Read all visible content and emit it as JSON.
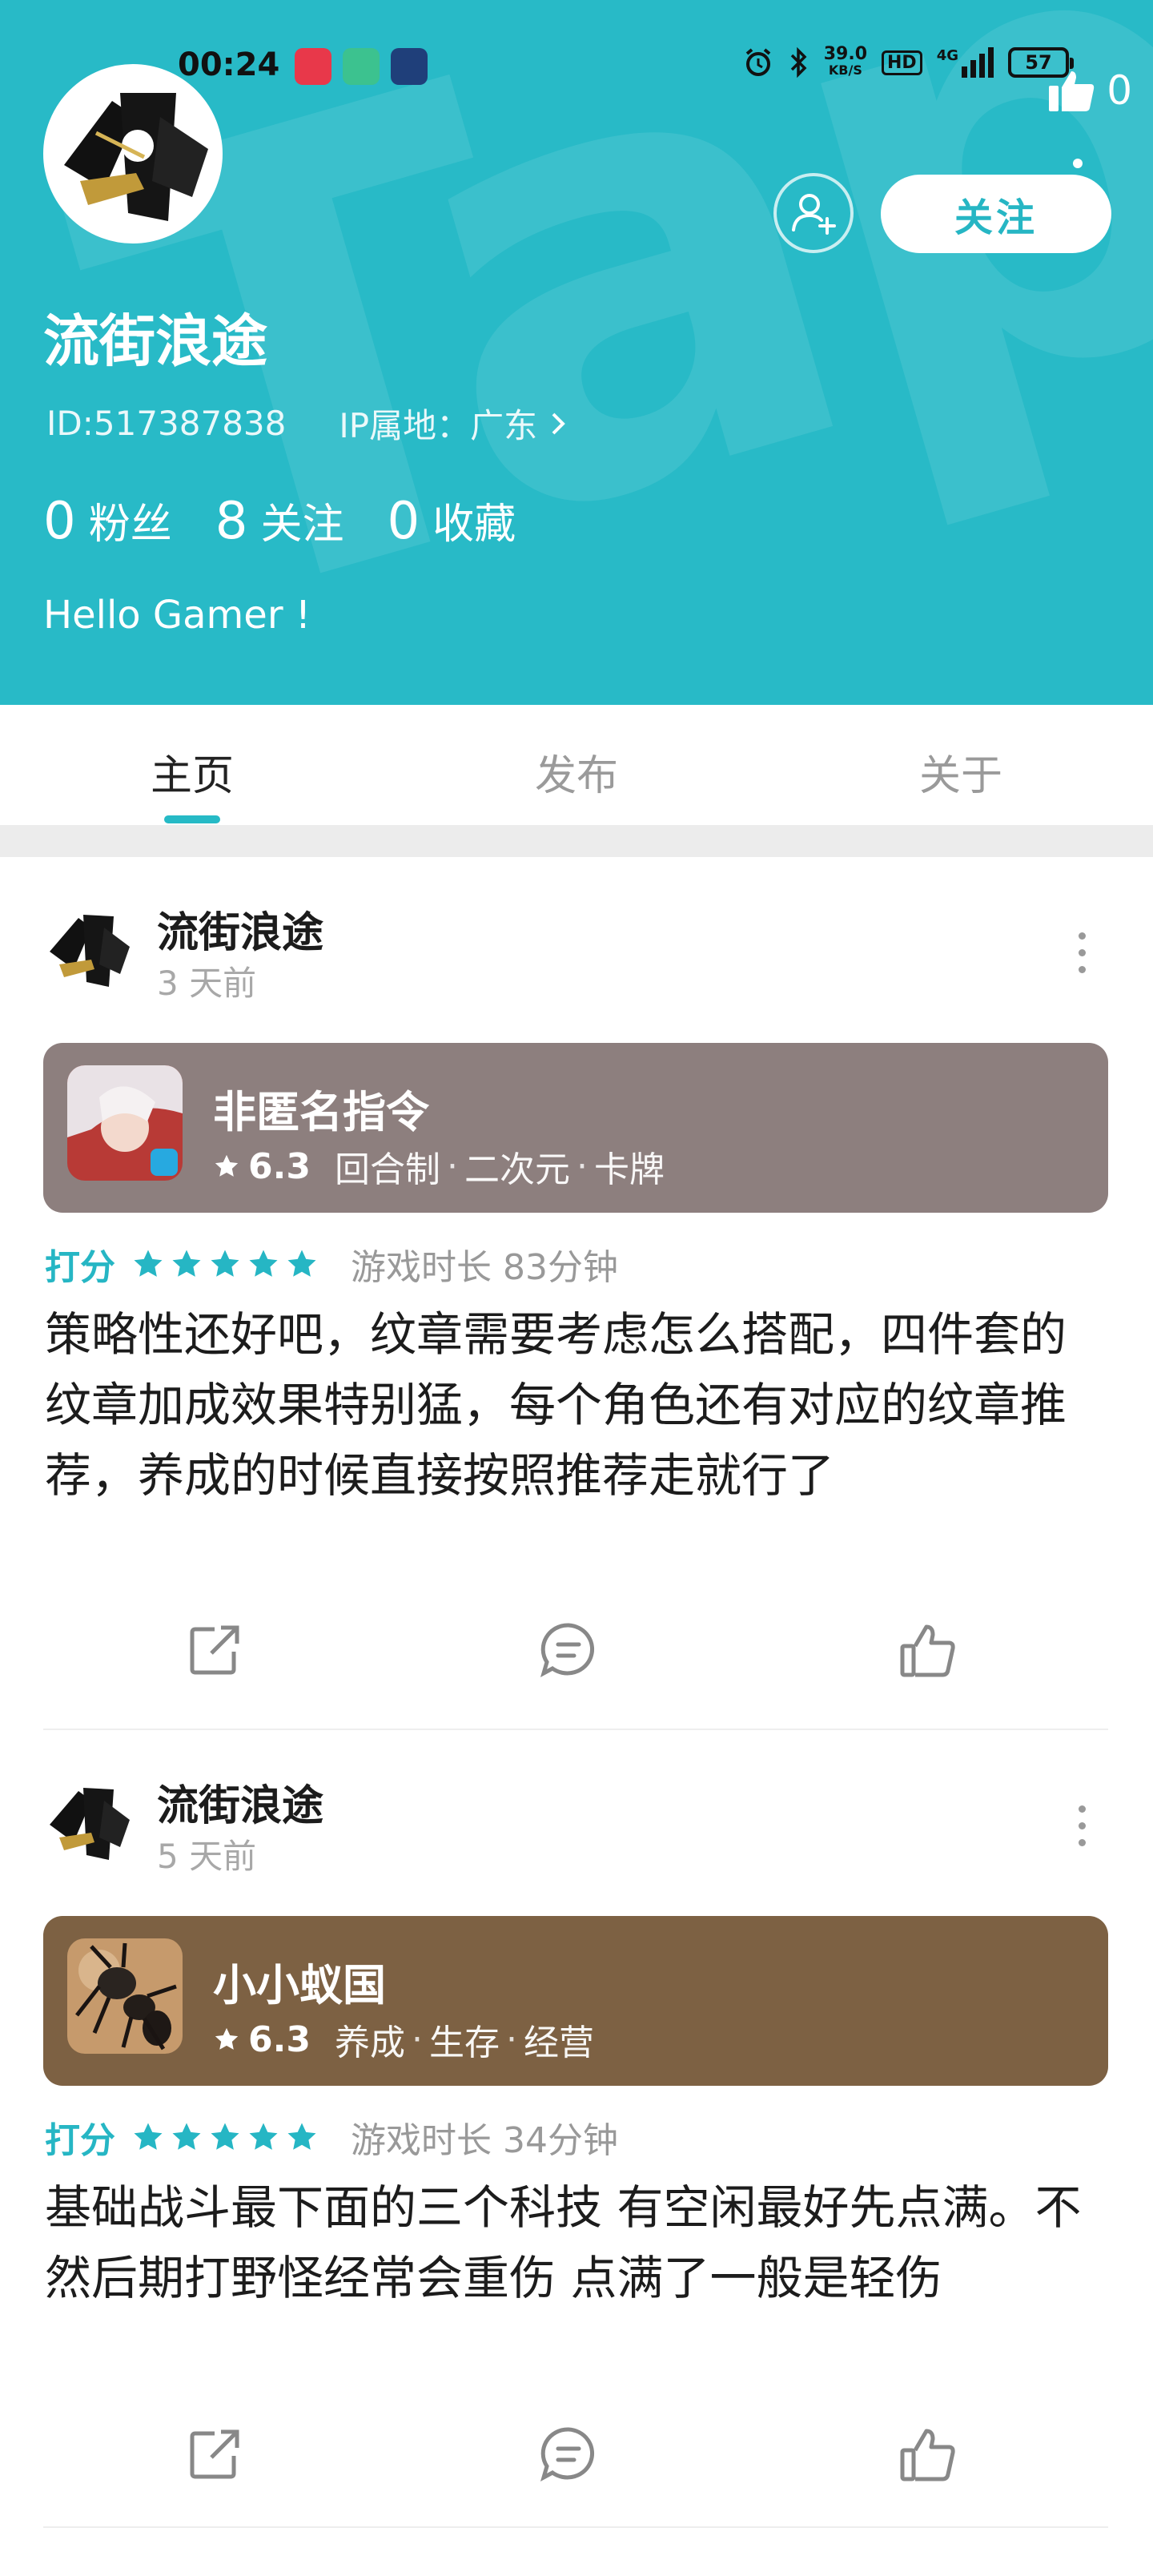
{
  "status_bar": {
    "time": "00:24",
    "net_speed_value": "39.0",
    "net_speed_unit": "KB/S",
    "hd": "HD",
    "signal": "4G",
    "battery": "57"
  },
  "profile": {
    "likes_count": "0",
    "follow_label": "关注",
    "name": "流街浪途",
    "id_text": "ID:517387838",
    "ip_text": "IP属地：广东",
    "stats": [
      {
        "num": "0",
        "label": "粉丝"
      },
      {
        "num": "8",
        "label": "关注"
      },
      {
        "num": "0",
        "label": "收藏"
      }
    ],
    "bio": "Hello Gamer !"
  },
  "tabs": [
    {
      "label": "主页",
      "active": true
    },
    {
      "label": "发布",
      "active": false
    },
    {
      "label": "关于",
      "active": false
    }
  ],
  "posts": [
    {
      "author": "流街浪途",
      "time": "3 天前",
      "game": {
        "title": "非匿名指令",
        "score": "6.3",
        "tags": [
          "回合制",
          "二次元",
          "卡牌"
        ],
        "card_color": "#8d7f7e"
      },
      "rating_label": "打分",
      "stars": 5,
      "playtime": "游戏时长 83分钟",
      "text": "策略性还好吧，纹章需要考虑怎么搭配，四件套的纹章加成效果特别猛，每个角色还有对应的纹章推荐，养成的时候直接按照推荐走就行了"
    },
    {
      "author": "流街浪途",
      "time": "5 天前",
      "game": {
        "title": "小小蚁国",
        "score": "6.3",
        "tags": [
          "养成",
          "生存",
          "经营"
        ],
        "card_color": "#7d6143"
      },
      "rating_label": "打分",
      "stars": 5,
      "playtime": "游戏时长 34分钟",
      "text": "基础战斗最下面的三个科技 有空闲最好先点满。不然后期打野怪经常会重伤 点满了一般是轻伤"
    }
  ],
  "colors": {
    "header_bg": "#28bac7",
    "accent": "#26b6c4"
  },
  "icons": [
    "alarm-icon",
    "bluetooth-icon",
    "signal-icon",
    "battery-icon",
    "thumbs-up-icon",
    "add-friend-icon",
    "star-icon",
    "share-icon",
    "comment-icon",
    "like-icon",
    "more-icon"
  ]
}
